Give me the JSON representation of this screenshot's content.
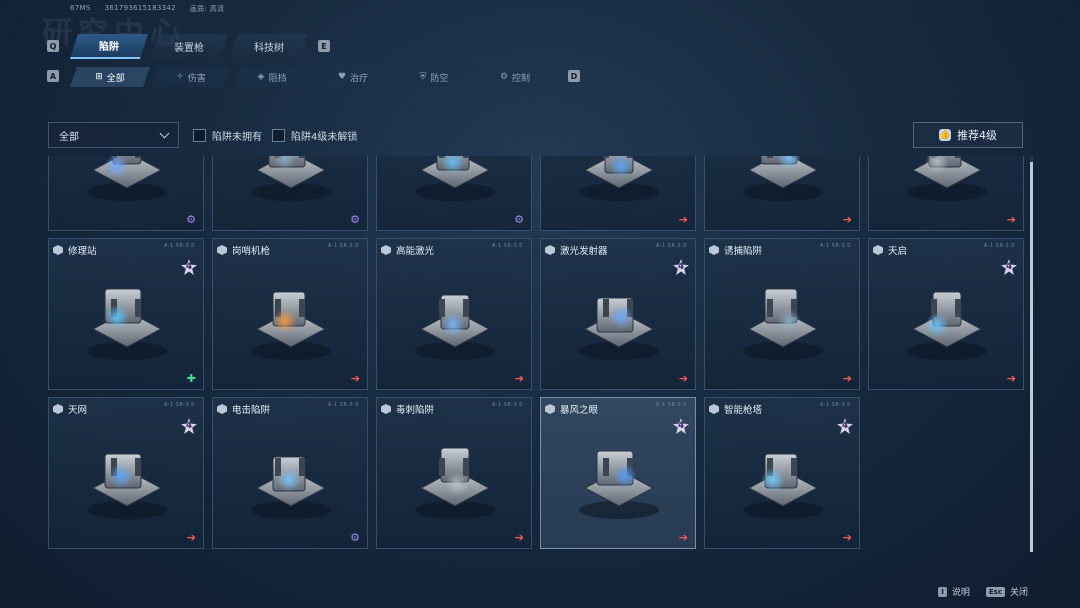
{
  "top_info": {
    "fps": "67MS",
    "uid": "3617936151833​42",
    "quality_label": "画质:",
    "quality_value": "高清"
  },
  "keys": {
    "prev_main": "Q",
    "next_main": "E",
    "prev_sub": "A",
    "next_sub": "D"
  },
  "main_tabs": [
    {
      "label": "陷阱",
      "active": true
    },
    {
      "label": "装置枪",
      "active": false
    },
    {
      "label": "科技树",
      "active": false
    }
  ],
  "sub_tabs": [
    {
      "label": "全部",
      "icon": "grid-icon",
      "glyph": "⊞",
      "active": true
    },
    {
      "label": "伤害",
      "icon": "damage-icon",
      "glyph": "✧",
      "active": false
    },
    {
      "label": "阻挡",
      "icon": "block-icon",
      "glyph": "◈",
      "active": false
    },
    {
      "label": "治疗",
      "icon": "heal-icon",
      "glyph": "♥",
      "active": false
    },
    {
      "label": "防空",
      "icon": "antiair-icon",
      "glyph": "⛨",
      "active": false
    },
    {
      "label": "控制",
      "icon": "control-icon",
      "glyph": "⚙",
      "active": false
    }
  ],
  "filter": {
    "dropdown_value": "全部",
    "check_unowned": "陷阱未拥有",
    "check_lv4_locked": "陷阱4级未解锁",
    "recommend": "推荐4级"
  },
  "cards_top_row": [
    {
      "icon": "gear",
      "glyph": "⚙"
    },
    {
      "icon": "gear",
      "glyph": "⚙"
    },
    {
      "icon": "gear",
      "glyph": "⚙"
    },
    {
      "icon": "arrow",
      "glyph": "➔"
    },
    {
      "icon": "arrow",
      "glyph": "➔"
    },
    {
      "icon": "arrow",
      "glyph": "➔"
    }
  ],
  "cards": [
    {
      "name": "修理站",
      "lv4": true,
      "icon": "heart",
      "glyph": "✚",
      "code": "A-1 SR-3.0"
    },
    {
      "name": "岗哨机枪",
      "lv4": false,
      "icon": "arrow",
      "glyph": "➔",
      "code": "A-1 SR-3.0"
    },
    {
      "name": "高能激光",
      "lv4": false,
      "icon": "arrow",
      "glyph": "➔",
      "code": "A-1 SR-3.0"
    },
    {
      "name": "激光发射器",
      "lv4": true,
      "icon": "arrow",
      "glyph": "➔",
      "code": "A-1 SR-3.0"
    },
    {
      "name": "诱捕陷阱",
      "lv4": false,
      "icon": "arrow",
      "glyph": "➔",
      "code": "A-1 SR-3.0"
    },
    {
      "name": "天启",
      "lv4": true,
      "icon": "arrow",
      "glyph": "➔",
      "code": "A-1 SR-3.0"
    },
    {
      "name": "天网",
      "lv4": true,
      "icon": "arrow",
      "glyph": "➔",
      "code": "A-1 SR-3.0"
    },
    {
      "name": "电击陷阱",
      "lv4": false,
      "icon": "gear",
      "glyph": "⚙",
      "code": "A-1 SR-3.0"
    },
    {
      "name": "毒刺陷阱",
      "lv4": false,
      "icon": "arrow",
      "glyph": "➔",
      "code": "A-1 SR-3.0"
    },
    {
      "name": "暴风之眼",
      "lv4": true,
      "icon": "arrow",
      "glyph": "➔",
      "code": "A-1 SR-3.0",
      "selected": true
    },
    {
      "name": "智能枪塔",
      "lv4": true,
      "icon": "arrow",
      "glyph": "➔",
      "code": "A-1 SR-3.0"
    }
  ],
  "badge_text": "4",
  "footer": {
    "help_key": "I",
    "help_label": "说明",
    "close_key": "Esc",
    "close_label": "关闭"
  }
}
